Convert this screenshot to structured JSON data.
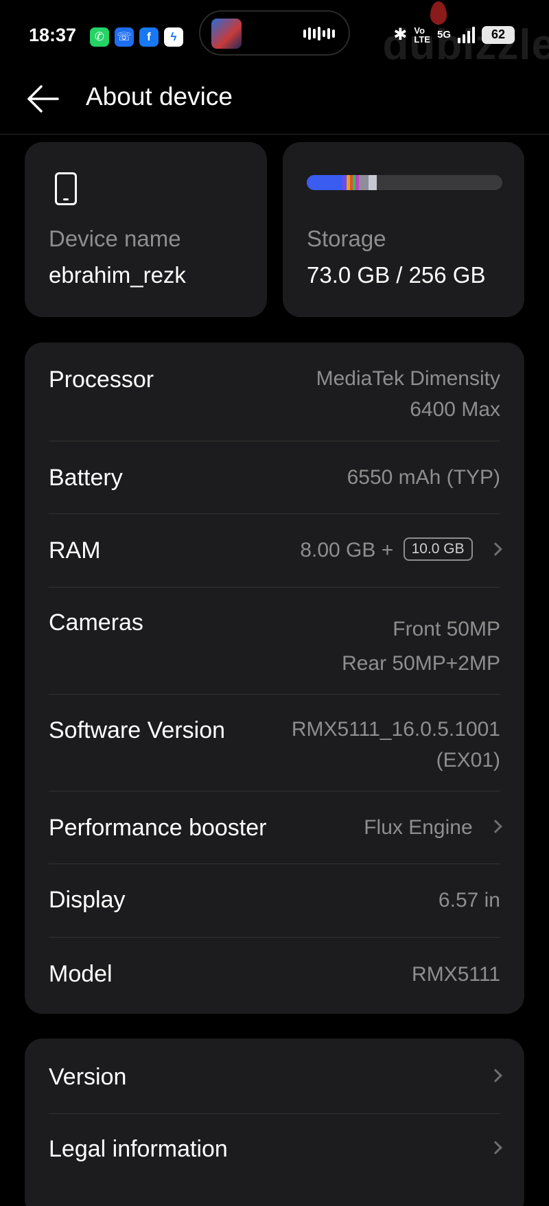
{
  "status_bar": {
    "time": "18:37",
    "notifications": [
      "whatsapp-icon",
      "phone-icon",
      "facebook-icon",
      "messenger-icon"
    ],
    "volte_top": "Vo",
    "volte_bottom": "LTE",
    "network": "5G",
    "battery": "62",
    "watermark": "dubizzle"
  },
  "header": {
    "title": "About device"
  },
  "device_card": {
    "label": "Device name",
    "value": "ebrahim_rezk"
  },
  "storage_card": {
    "label": "Storage",
    "value": "73.0 GB / 256 GB",
    "used_fraction": 0.285
  },
  "specs": {
    "processor": {
      "label": "Processor",
      "value_line1": "MediaTek Dimensity",
      "value_line2": "6400 Max"
    },
    "battery": {
      "label": "Battery",
      "value": "6550 mAh (TYP)"
    },
    "ram": {
      "label": "RAM",
      "value": "8.00 GB +",
      "badge": "10.0 GB"
    },
    "cameras": {
      "label": "Cameras",
      "value_line1": "Front 50MP",
      "value_line2": "Rear 50MP+2MP"
    },
    "software": {
      "label": "Software Version",
      "value_line1": "RMX5111_16.0.5.1001",
      "value_line2": "(EX01)"
    },
    "booster": {
      "label": "Performance booster",
      "value": "Flux Engine"
    },
    "display": {
      "label": "Display",
      "value": "6.57 in"
    },
    "model": {
      "label": "Model",
      "value": "RMX5111"
    }
  },
  "bottom": {
    "version": "Version",
    "legal": "Legal information"
  },
  "colors": {
    "background": "#000000",
    "card": "#1c1c1e",
    "secondary_text": "#8e8e8e"
  }
}
